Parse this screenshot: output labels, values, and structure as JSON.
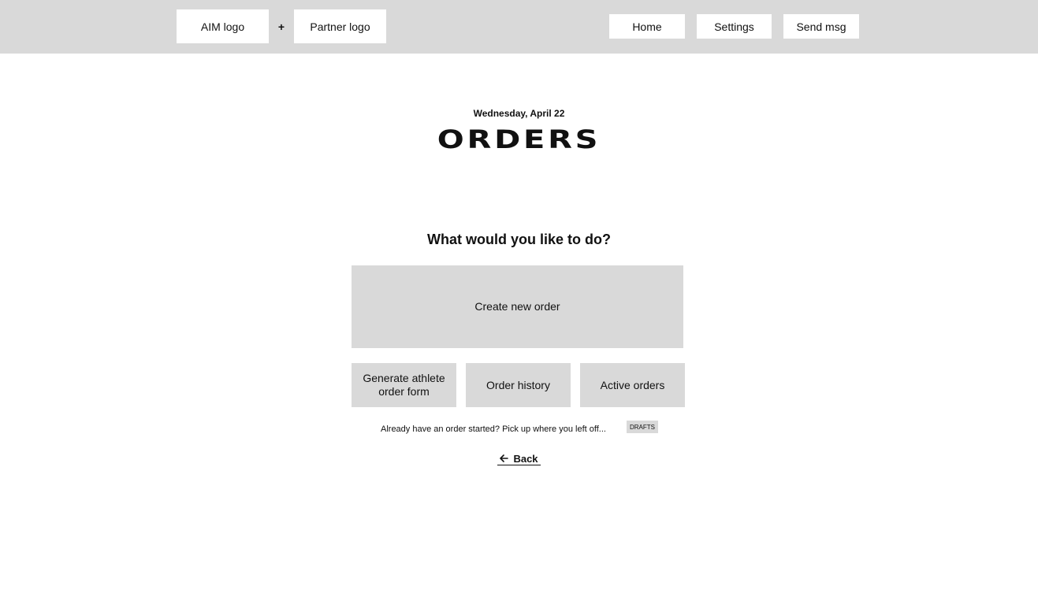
{
  "header": {
    "aim_logo": "AIM logo",
    "plus": "+",
    "partner_logo": "Partner logo",
    "nav": {
      "home": "Home",
      "settings": "Settings",
      "send_msg": "Send msg"
    }
  },
  "page": {
    "date": "Wednesday, April 22",
    "title": "ORDERS",
    "prompt": "What would you like to do?"
  },
  "actions": {
    "create_new_order": "Create new order",
    "generate_athlete_form": "Generate athlete order form",
    "order_history": "Order history",
    "active_orders": "Active orders"
  },
  "drafts": {
    "resume_text": "Already have an order started? Pick up where you left off...",
    "badge": "DRAFTS"
  },
  "back": {
    "icon": "arrow-left-icon",
    "label": "Back"
  },
  "colors": {
    "header_bg": "#d9d9d9",
    "button_bg": "#d9d9d9",
    "text": "#111111"
  }
}
